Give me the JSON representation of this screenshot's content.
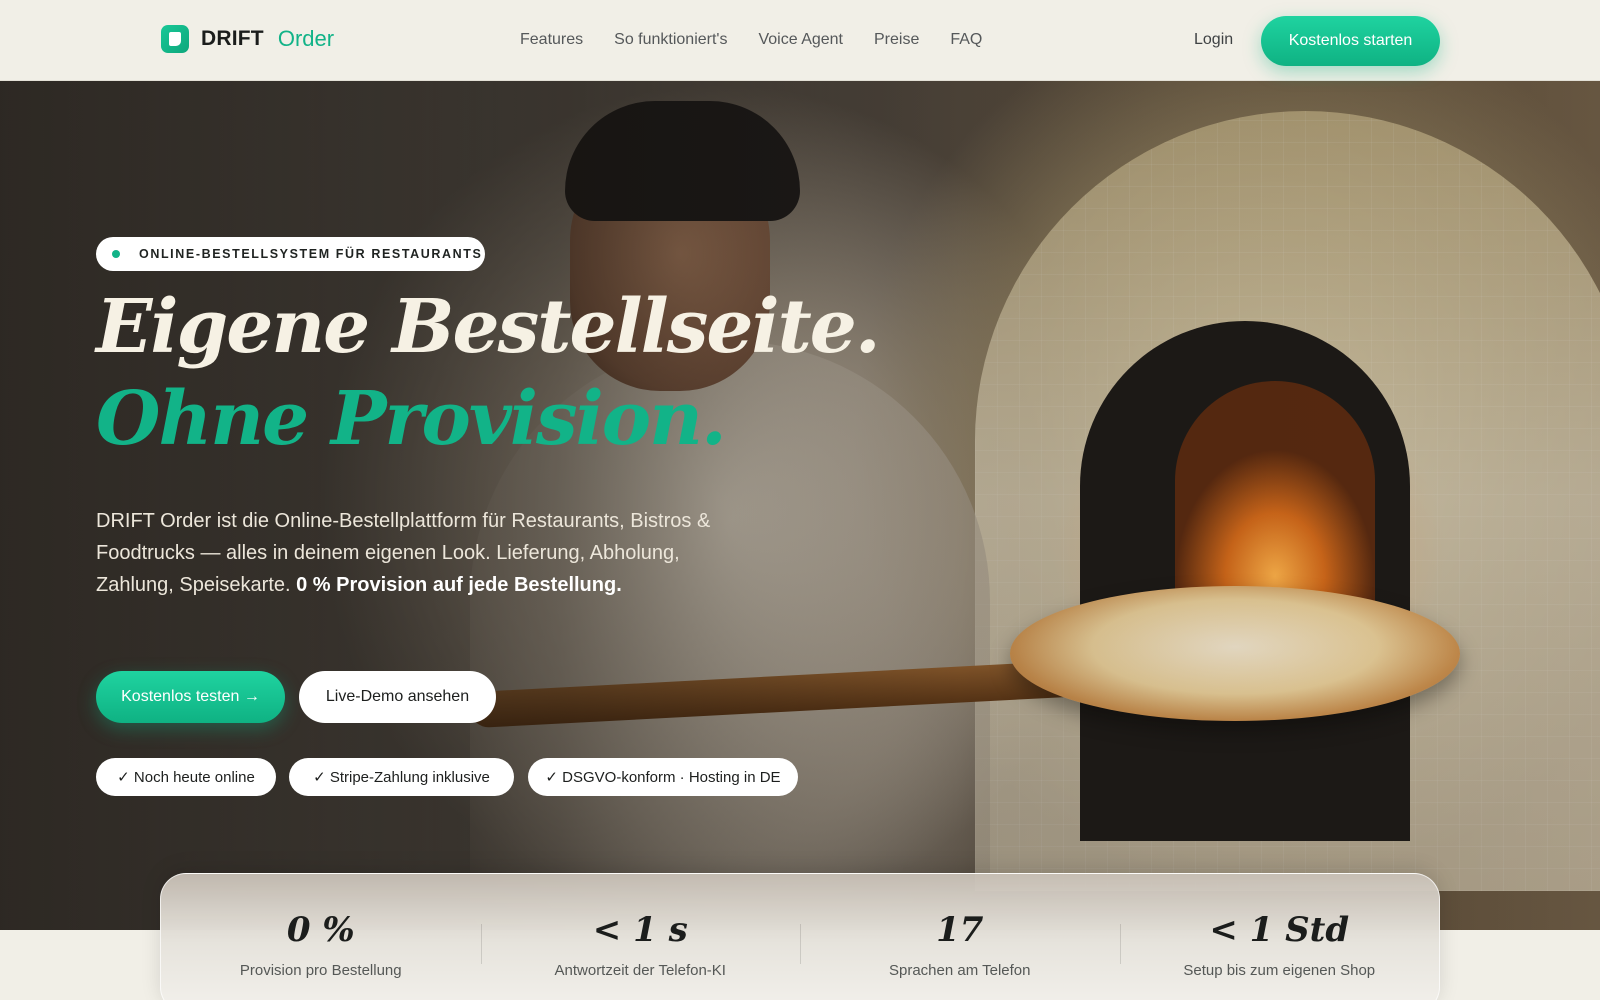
{
  "nav": {
    "logo_text": "DRIFT",
    "logo_accent": "Order",
    "links": [
      "Features",
      "So funktioniert's",
      "Voice Agent",
      "Preise",
      "FAQ"
    ],
    "login": "Login",
    "cta": "Kostenlos starten"
  },
  "hero": {
    "badge": "ONLINE-BESTELLSYSTEM FÜR RESTAURANTS",
    "headline_line1": "Eigene Bestellseite.",
    "headline_line2": "Ohne Provision.",
    "description": "DRIFT Order ist die Online-Bestellplattform für Restaurants, Bistros & Foodtrucks — alles in deinem eigenen Look. Lieferung, Abholung, Zahlung, Speisekarte.",
    "description_bold": "0 % Provision auf jede Bestellung.",
    "primary_button": "Kostenlos testen →",
    "secondary_button": "Live-Demo ansehen",
    "pills": [
      "✓ Noch heute online",
      "✓ Stripe-Zahlung inklusive",
      "✓ DSGVO-konform · Hosting in DE"
    ]
  },
  "stats": [
    {
      "value": "0 %",
      "label": "Provision pro Bestellung"
    },
    {
      "value": "< 1 s",
      "label": "Antwortzeit der Telefon-KI"
    },
    {
      "value": "17",
      "label": "Sprachen am Telefon"
    },
    {
      "value": "< 1 Std",
      "label": "Setup bis zum eigenen Shop"
    }
  ],
  "colors": {
    "accent": "#12b388",
    "background": "#f1efe7",
    "text_dark": "#1b1d1c"
  },
  "icons": {
    "logo": "drift-logo-icon",
    "badge_dot": "status-dot-icon"
  }
}
